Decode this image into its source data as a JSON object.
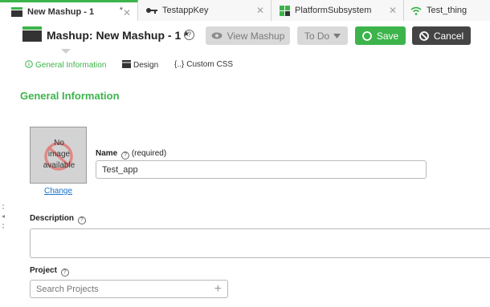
{
  "tabs": [
    {
      "label": "New Mashup - 1",
      "dirty": "*",
      "icon": "mashup-icon",
      "active": true
    },
    {
      "label": "TestappKey",
      "icon": "key-icon",
      "active": false
    },
    {
      "label": "PlatformSubsystem",
      "icon": "subsystem-icon",
      "active": false
    },
    {
      "label": "Test_thing",
      "icon": "wifi-icon",
      "active": false
    }
  ],
  "header": {
    "title": "Mashup: New Mashup - 1 *",
    "help": "?",
    "view_mashup": "View Mashup",
    "todo": "To Do",
    "save": "Save",
    "cancel": "Cancel"
  },
  "subtabs": [
    {
      "label": "General Information",
      "icon": "info-icon",
      "active": true
    },
    {
      "label": "Design",
      "icon": "design-icon",
      "active": false
    },
    {
      "label": "Custom CSS",
      "icon": "css-braces-icon",
      "active": false
    }
  ],
  "section": {
    "title": "General Information"
  },
  "image": {
    "placeholder_line1": "No",
    "placeholder_line2": "image",
    "placeholder_line3": "available",
    "change": "Change"
  },
  "name": {
    "label": "Name",
    "required": "(required)",
    "value": "Test_app"
  },
  "description": {
    "label": "Description",
    "value": ""
  },
  "project": {
    "label": "Project",
    "placeholder": "Search Projects"
  },
  "colors": {
    "accent": "#3cb44b",
    "dark": "#444444",
    "disabled": "#d9d9d9",
    "link": "#1a73c7"
  }
}
